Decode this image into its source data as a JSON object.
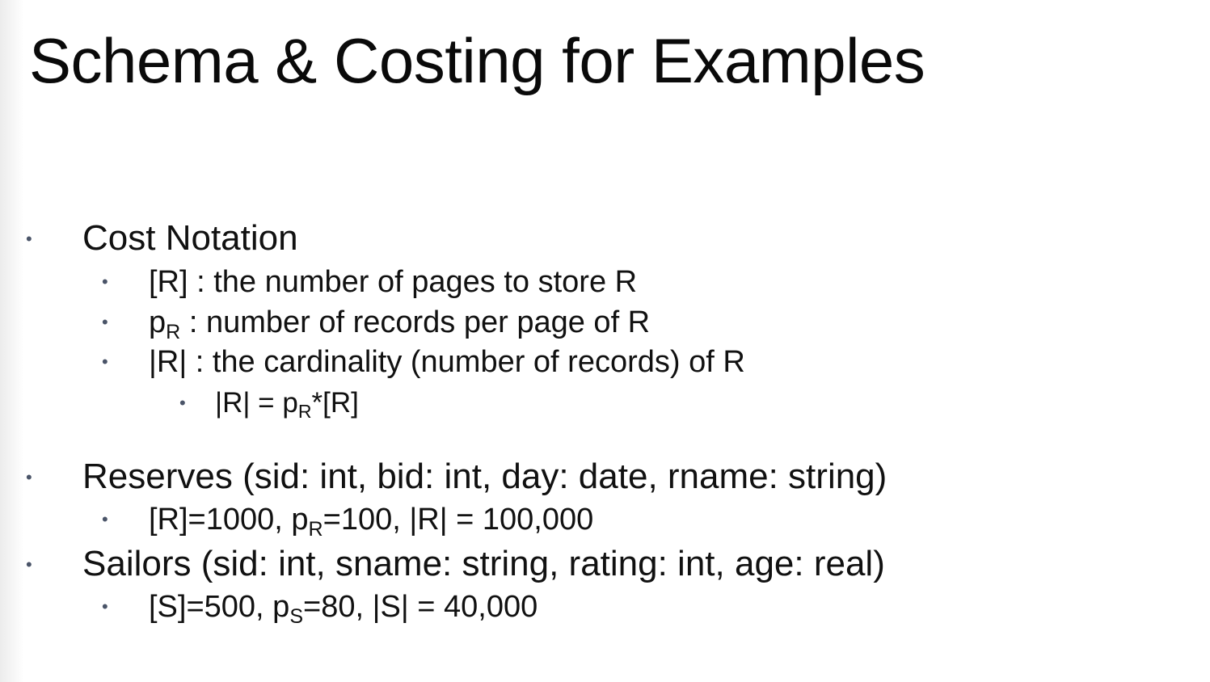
{
  "slide": {
    "title": "Schema & Costing for Examples"
  },
  "cost_notation": {
    "heading": "Cost Notation",
    "item1": "[R] : the number of pages to store R",
    "item2": {
      "p": "p",
      "sub": "R",
      "rest": " : number of records per page of R"
    },
    "item3": "|R| : the cardinality (number of records) of R",
    "item3_sub": {
      "pre": "|R| = p",
      "sub": "R",
      "post": "*[R]"
    }
  },
  "reserves": {
    "heading": "Reserves (sid: int, bid: int, day: date, rname: string)",
    "stats": {
      "pre": "[R]=1000, p",
      "sub": "R",
      "post": "=100, |R| = 100,000"
    }
  },
  "sailors": {
    "heading": "Sailors (sid: int, sname: string, rating: int, age: real)",
    "stats": {
      "pre": "[S]=500, p",
      "sub": "S",
      "post": "=80, |S| = 40,000"
    }
  },
  "colors": {
    "bullet": "#4a5468",
    "text": "#111111"
  }
}
